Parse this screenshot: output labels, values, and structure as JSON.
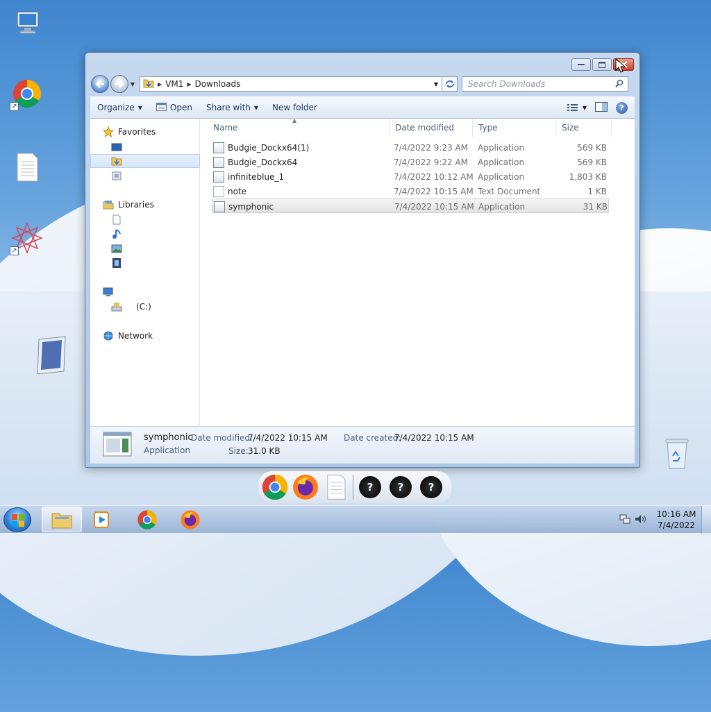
{
  "window": {
    "caption": {
      "minimize": "minimize",
      "maximize": "maximize",
      "close": "close"
    },
    "address": {
      "segments": [
        "VM1",
        "Downloads"
      ]
    },
    "search": {
      "placeholder": "Search Downloads"
    },
    "toolbar": {
      "organize": "Organize",
      "open": "Open",
      "share_with": "Share with",
      "new_folder": "New folder"
    },
    "nav_pane": {
      "favorites": "Favorites",
      "libraries": "Libraries",
      "drive": "(C:)",
      "network": "Network"
    },
    "columns": {
      "name": "Name",
      "date": "Date modified",
      "type": "Type",
      "size": "Size"
    },
    "files": [
      {
        "name": "Budgie_Dockx64(1)",
        "date": "7/4/2022 9:23 AM",
        "type": "Application",
        "size": "569 KB",
        "icon": "app"
      },
      {
        "name": "Budgie_Dockx64",
        "date": "7/4/2022 9:22 AM",
        "type": "Application",
        "size": "569 KB",
        "icon": "app"
      },
      {
        "name": "infiniteblue_1",
        "date": "7/4/2022 10:12 AM",
        "type": "Application",
        "size": "1,803 KB",
        "icon": "app"
      },
      {
        "name": "note",
        "date": "7/4/2022 10:15 AM",
        "type": "Text Document",
        "size": "1 KB",
        "icon": "doc"
      },
      {
        "name": "symphonic",
        "date": "7/4/2022 10:15 AM",
        "type": "Application",
        "size": "31 KB",
        "icon": "app",
        "selected": true
      }
    ],
    "details": {
      "name": "symphonic",
      "type": "Application",
      "date_modified_label": "Date modified:",
      "date_modified": "7/4/2022 10:15 AM",
      "date_created_label": "Date created:",
      "date_created": "7/4/2022 10:15 AM",
      "size_label": "Size:",
      "size": "31.0 KB"
    }
  },
  "dock": {
    "items": [
      "chrome-icon",
      "firefox-icon",
      "notepad-icon",
      "unknown-app-icon",
      "unknown-app-icon",
      "unknown-app-icon"
    ]
  },
  "taskbar": {
    "time": "10:16 AM",
    "date": "7/4/2022"
  },
  "colors": {
    "accent": "#2b5aa4",
    "close_button": "#c9442b"
  }
}
